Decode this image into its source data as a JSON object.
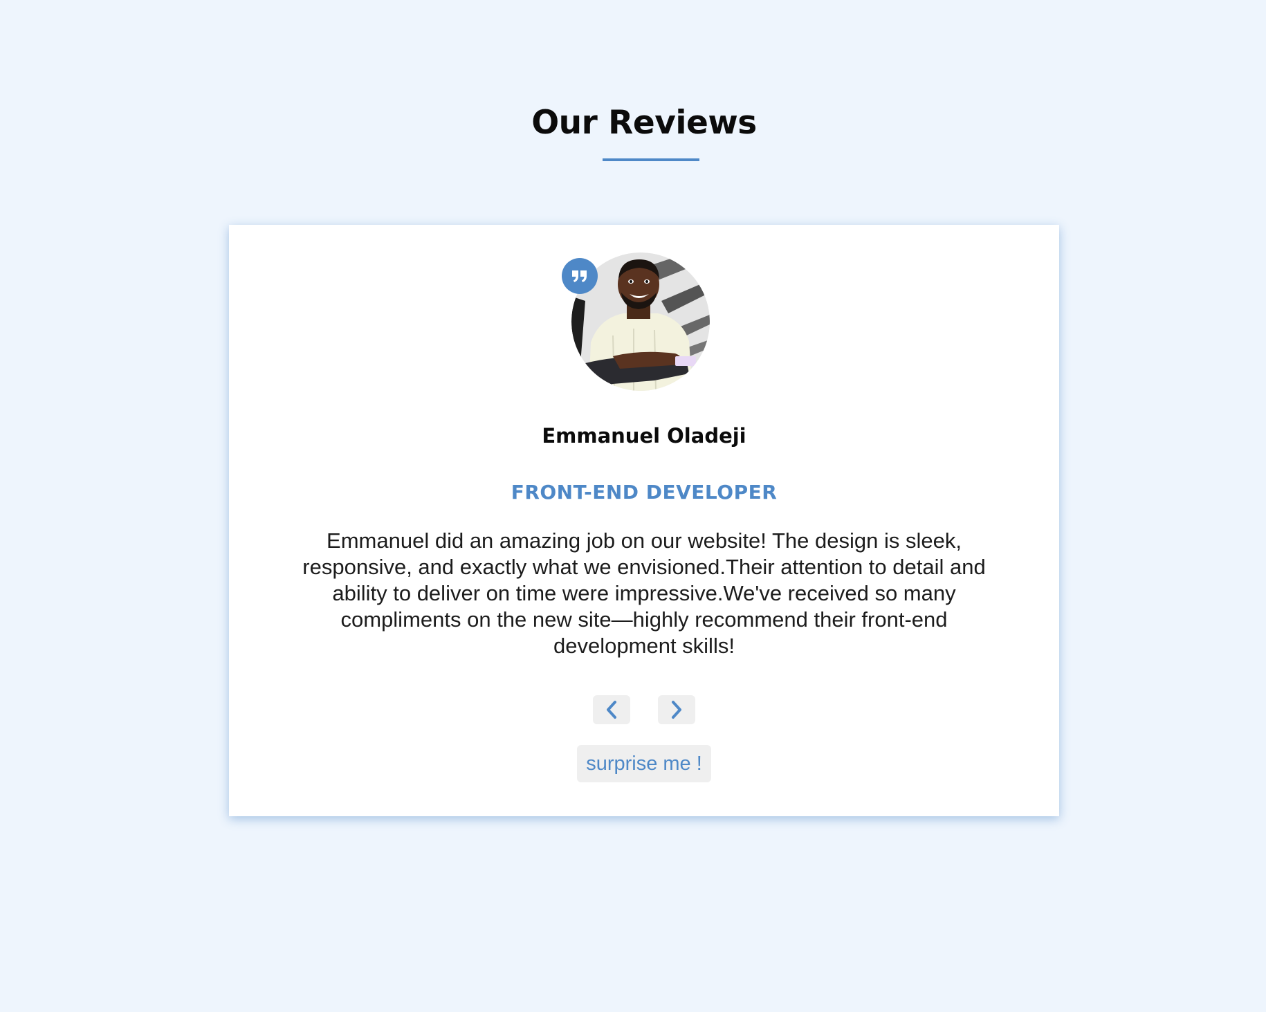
{
  "section": {
    "title": "Our Reviews"
  },
  "review": {
    "author": "Emmanuel Oladeji",
    "job": "FRONT-END DEVELOPER",
    "text": "Emmanuel did an amazing job on our website! The design is sleek, responsive, and exactly what we envisioned.Their attention to detail and ability to deliver on time were impressive.We've received so many compliments on the new site—highly recommend their front-end development skills!"
  },
  "controls": {
    "prev_icon": "chevron-left-icon",
    "next_icon": "chevron-right-icon",
    "random_label": "surprise me !"
  },
  "colors": {
    "background": "#eef5fd",
    "accent": "#4e88c7",
    "card": "#ffffff",
    "button_bg": "#efefef",
    "text": "#0b0b0b"
  }
}
